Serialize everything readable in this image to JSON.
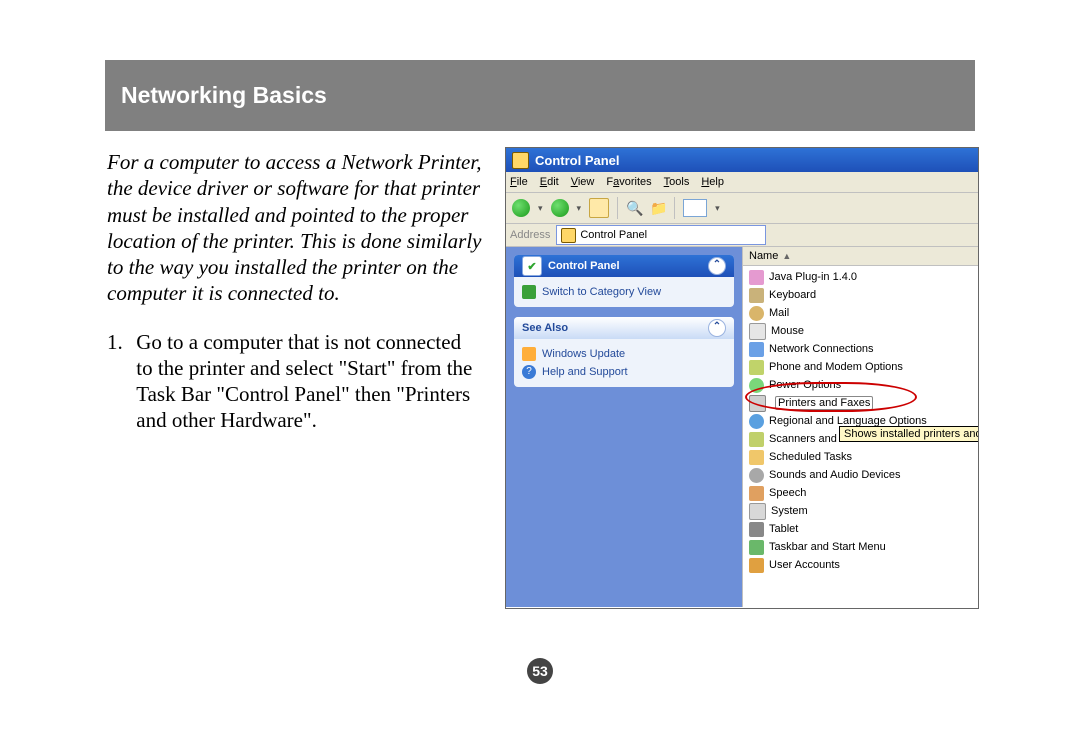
{
  "header": {
    "title": "Networking Basics"
  },
  "intro": "For a computer to access a Network Printer, the device driver or software for that printer must be installed and pointed to the proper location of the printer.  This is done similarly to the way you installed the printer on the computer it is connected to.",
  "step1": {
    "num": "1.",
    "text": "Go to a computer that is not connected to the printer and select \"Start\" from the Task Bar \"Control Panel\" then \"Printers and other Hardware\"."
  },
  "page_number": "53",
  "shot": {
    "title": "Control Panel",
    "menus": {
      "file": "File",
      "edit": "Edit",
      "view": "View",
      "favorites": "Favorites",
      "tools": "Tools",
      "help": "Help"
    },
    "address": {
      "label": "Address",
      "value": "Control Panel"
    },
    "side": {
      "panel1": {
        "title": "Control Panel",
        "link": "Switch to Category View"
      },
      "panel2": {
        "title": "See Also",
        "links": [
          "Windows Update",
          "Help and Support"
        ]
      }
    },
    "list": {
      "header": "Name",
      "items": [
        "Java Plug-in 1.4.0",
        "Keyboard",
        "Mail",
        "Mouse",
        "Network Connections",
        "Phone and Modem Options",
        "Power Options",
        "Printers and Faxes",
        "Regional and Language Options",
        "Scanners and",
        "Scheduled Tasks",
        "Sounds and Audio Devices",
        "Speech",
        "System",
        "Tablet",
        "Taskbar and Start Menu",
        "User Accounts"
      ],
      "tooltip": "Shows installed printers and f"
    }
  }
}
